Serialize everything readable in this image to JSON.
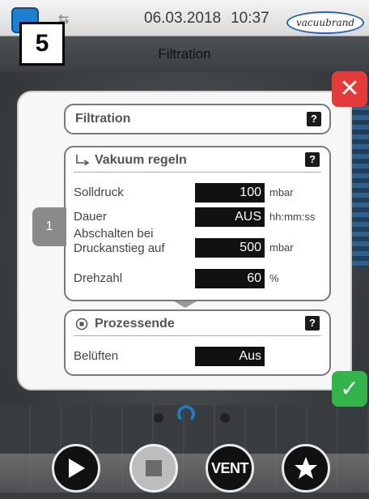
{
  "status_bar": {
    "date": "06.03.2018",
    "time": "10:37",
    "logo_text": "vacuubrand"
  },
  "step_badge": "5",
  "screen_title": "Filtration",
  "section_filtration": {
    "title": "Filtration",
    "help": "?"
  },
  "section_vacuum": {
    "title": "Vakuum regeln",
    "help": "?",
    "rows": [
      {
        "label": "Solldruck",
        "value": "100",
        "unit": "mbar"
      },
      {
        "label": "Dauer",
        "value": "AUS",
        "unit": "hh:mm:ss"
      },
      {
        "label": "Abschalten bei Druckanstieg auf",
        "value": "500",
        "unit": "mbar"
      },
      {
        "label": "Drehzahl",
        "value": "60",
        "unit": "%"
      }
    ]
  },
  "section_end": {
    "title": "Prozessende",
    "help": "?",
    "rows": [
      {
        "label": "Belüften",
        "value": "Aus"
      }
    ]
  },
  "step_number": "1",
  "controls": {
    "vent_label": "VENT"
  },
  "colors": {
    "close": "#e43a3a",
    "confirm": "#34b34a",
    "accent": "#1e78c8"
  }
}
